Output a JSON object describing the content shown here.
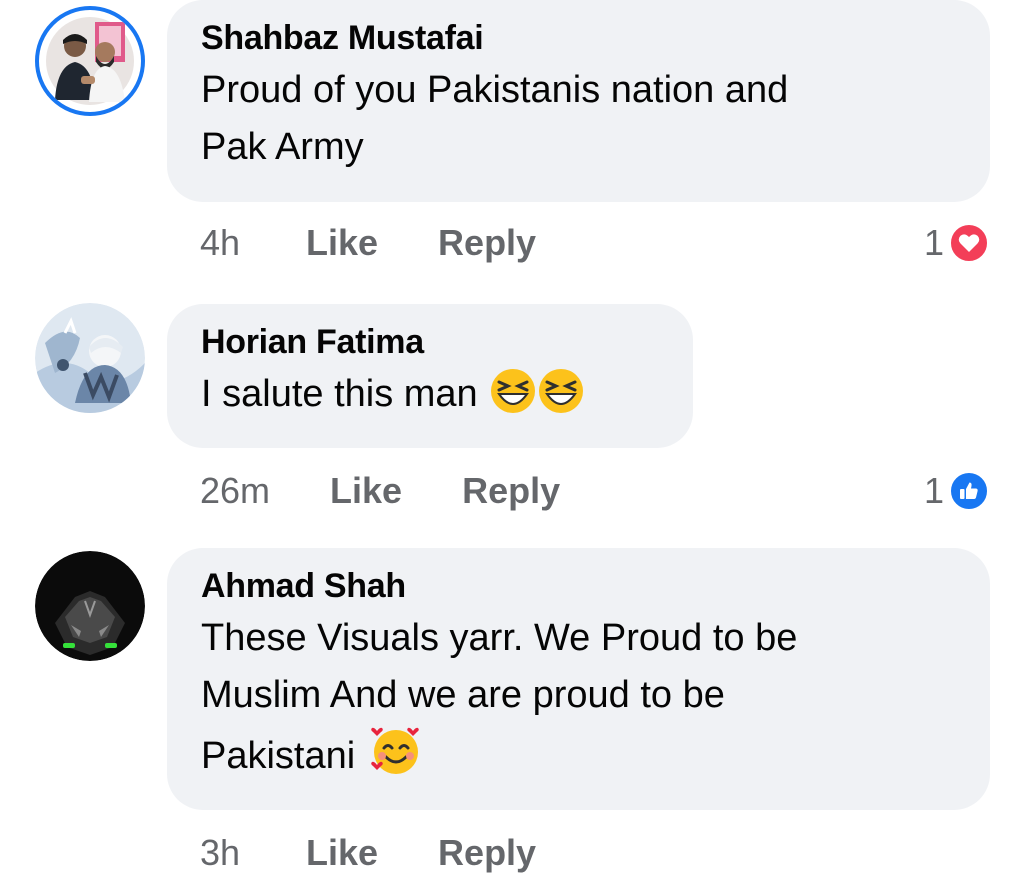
{
  "comments": [
    {
      "author": "Shahbaz Mustafai",
      "text_line1": "Proud of you Pakistanis nation and",
      "text_line2": "Pak Army",
      "time": "4h",
      "like_label": "Like",
      "reply_label": "Reply",
      "reaction_count": "1",
      "reaction_icon": "heart-icon",
      "reaction_color": "#f33e58"
    },
    {
      "author": "Horian Fatima",
      "text_line1": "I salute this man",
      "emojis": [
        "laughing-squint-emoji",
        "laughing-squint-emoji"
      ],
      "time": "26m",
      "like_label": "Like",
      "reply_label": "Reply",
      "reaction_count": "1",
      "reaction_icon": "thumbs-up-icon",
      "reaction_color": "#1877f2"
    },
    {
      "author": "Ahmad Shah",
      "text_line1": "These Visuals yarr. We Proud to be",
      "text_line2": "Muslim And we are proud to be",
      "text_line3": "Pakistani",
      "emojis": [
        "smiling-face-with-hearts-emoji"
      ],
      "time": "3h",
      "like_label": "Like",
      "reply_label": "Reply"
    }
  ],
  "colors": {
    "bubble": "#f0f2f5",
    "meta_text": "#65676b",
    "story_ring": "#1877f2"
  }
}
